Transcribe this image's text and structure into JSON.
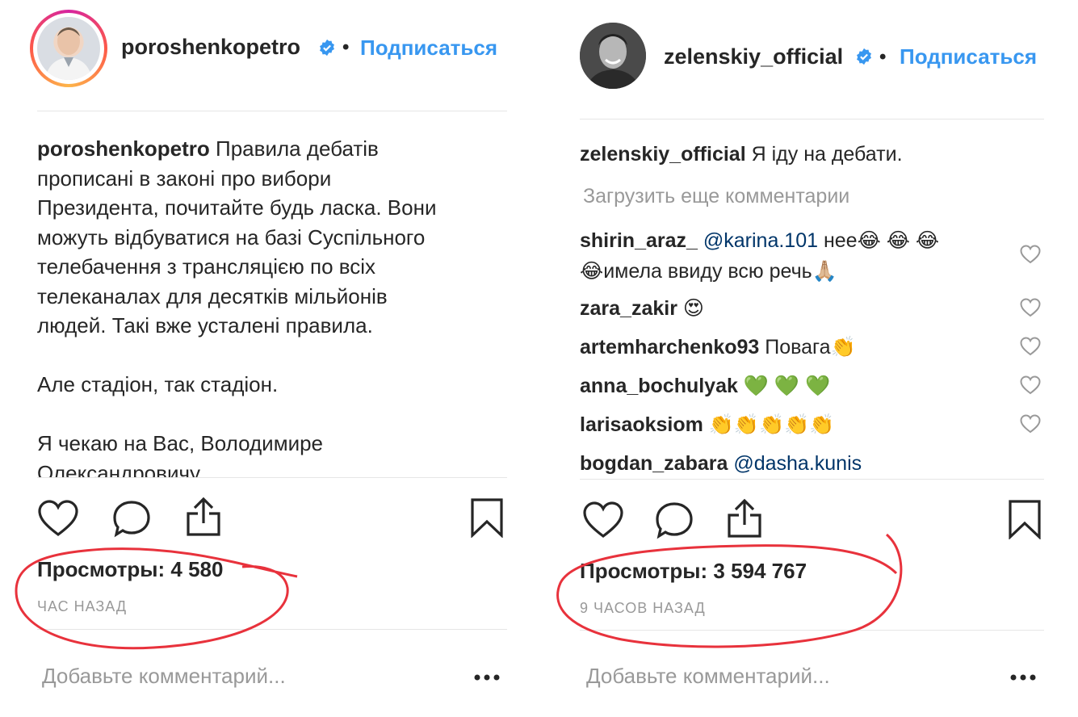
{
  "left_post": {
    "username": "poroshenkopetro",
    "follow_label": "Подписаться",
    "caption_user": "poroshenkopetro",
    "caption_text": " Правила дебатів\nпрописані в законі про вибори\nПрезидента, почитайте будь ласка. Вони\nможуть відбуватися на базі Суспільного\nтелебачення з трансляцією по всіх\nтелеканалах для десятків мільйонів\nлюдей. Такі вже усталені правила.\n\nАле стадіон, так стадіон.\n\nЯ чекаю на Вас, Володимире\nОлександровичу.",
    "views": "Просмотры: 4 580",
    "time": "ЧАС НАЗАД",
    "add_comment_placeholder": "Добавьте комментарий..."
  },
  "right_post": {
    "username": "zelenskiy_official",
    "follow_label": "Подписаться",
    "caption_user": "zelenskiy_official",
    "caption_text": " Я іду на дебати.",
    "load_more": "Загрузить еще комментарии",
    "comments": [
      {
        "user": "shirin_araz_",
        "mention": "@karina.101",
        "text": " нее😂 😂 😂",
        "text2": "😂имела ввиду всю речь🙏🏼"
      },
      {
        "user": "zara_zakir",
        "mention": "",
        "text": " 😍",
        "text2": ""
      },
      {
        "user": "artemharchenko93",
        "mention": "",
        "text": " Повага👏",
        "text2": ""
      },
      {
        "user": "anna_bochulyak",
        "mention": "",
        "text": " 💚 💚 💚",
        "text2": ""
      },
      {
        "user": "larisaoksiom",
        "mention": "",
        "text": " 👏👏👏👏👏",
        "text2": ""
      },
      {
        "user": "bogdan_zabara",
        "mention": "@dasha.kunis",
        "text": "",
        "text2": ""
      }
    ],
    "views": "Просмотры: 3 594 767",
    "time": "9 ЧАСОВ НАЗАД",
    "add_comment_placeholder": "Добавьте комментарий..."
  },
  "colors": {
    "link_blue": "#3897f0",
    "mention_blue": "#003569",
    "verified_blue": "#3897f0",
    "annotation_red": "#e8323c"
  }
}
